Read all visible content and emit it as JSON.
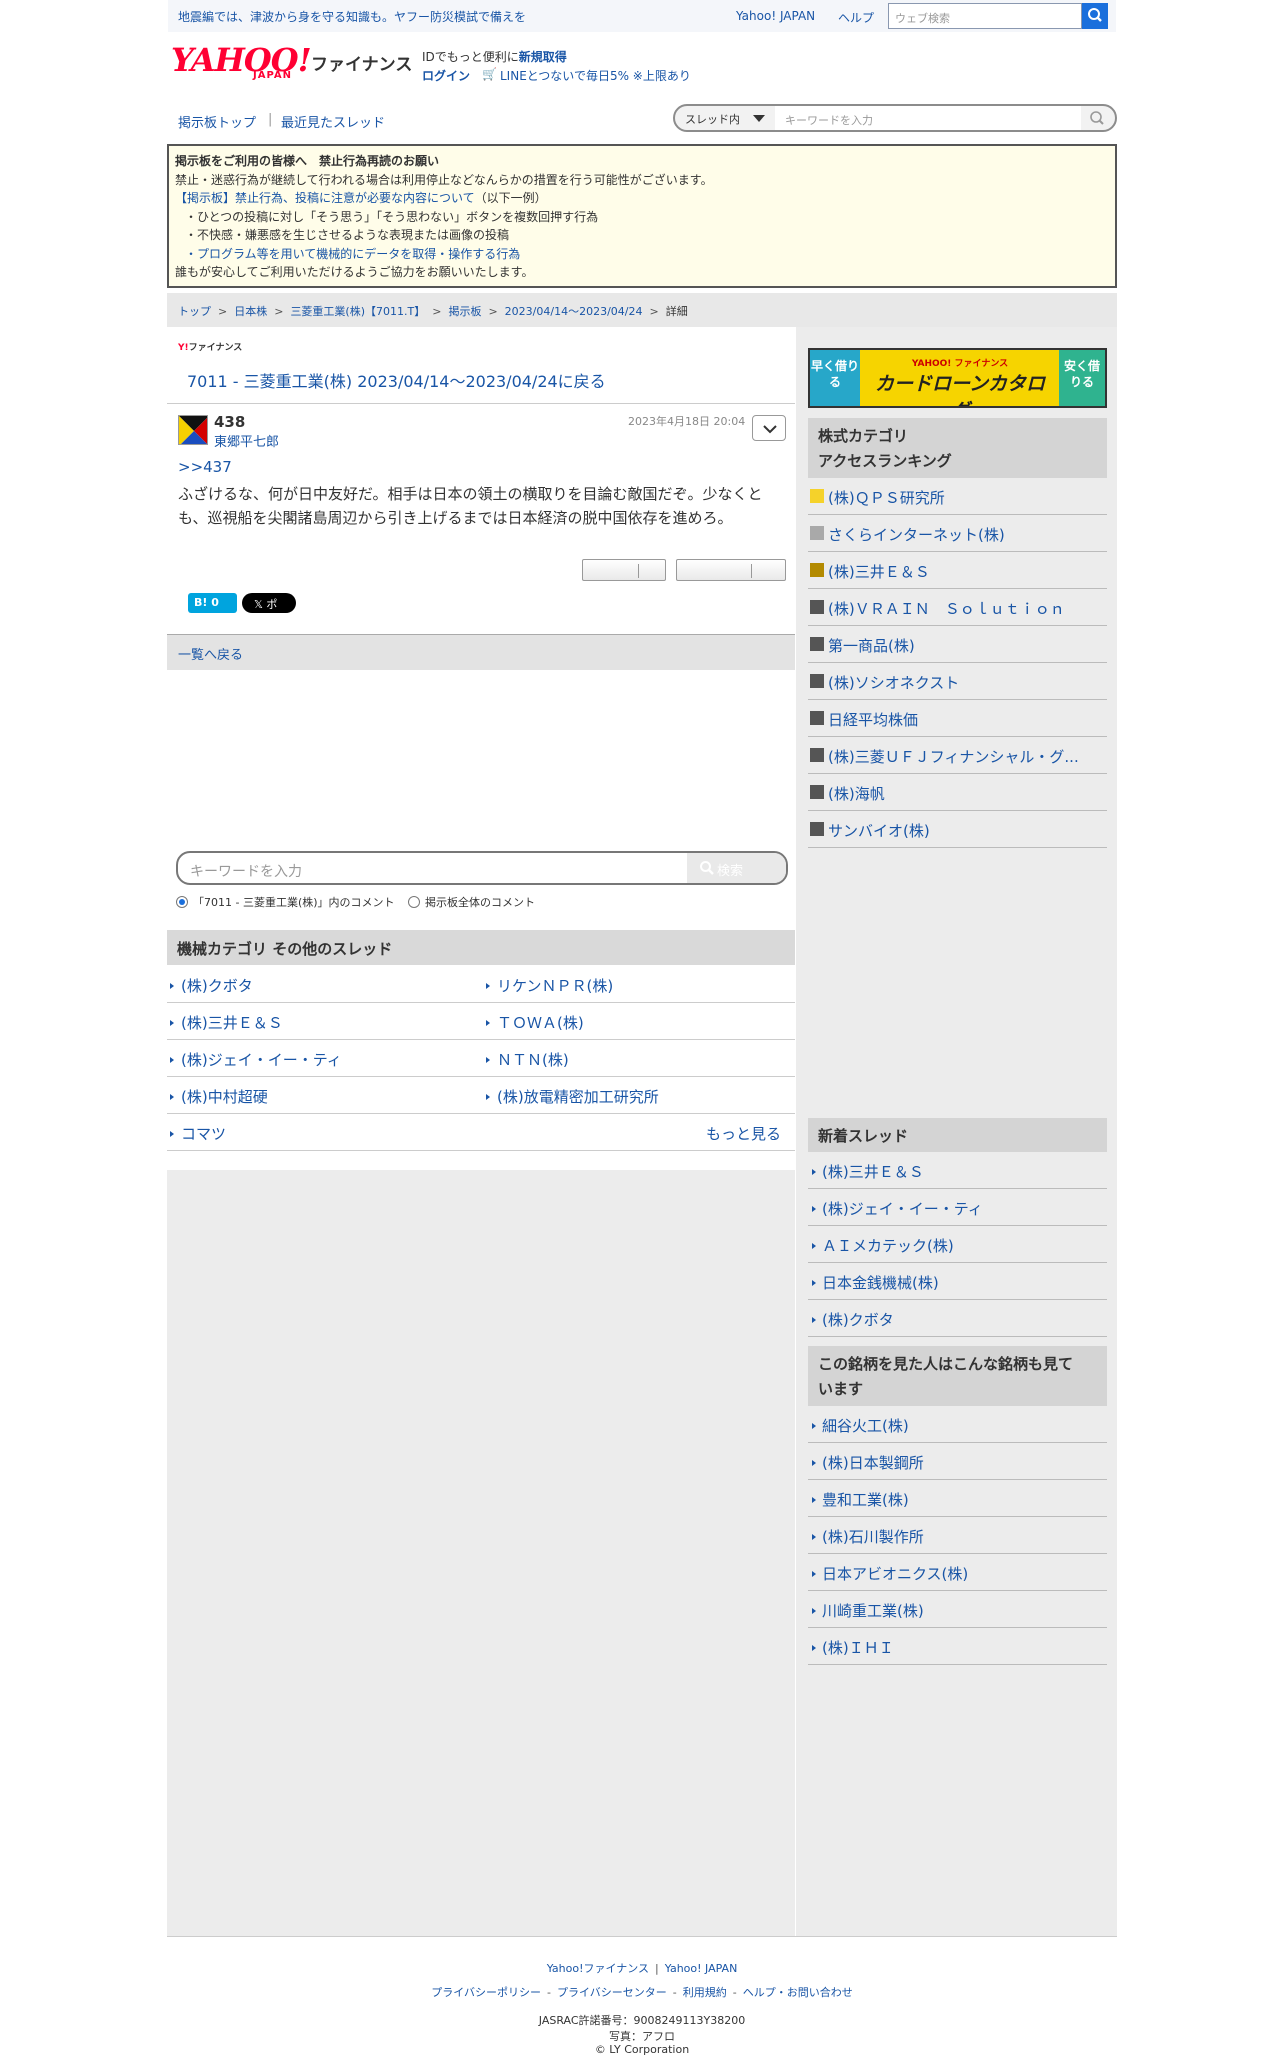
{
  "promo": "地震編では、津波から身を守る知識も。ヤフー防災模試で備えを",
  "top_links": {
    "yahoo_japan": "Yahoo! JAPAN",
    "help": "ヘルプ"
  },
  "web_search": {
    "placeholder": "ウェブ検索"
  },
  "logo": {
    "yahoo": "YAHOO!",
    "japan": "JAPAN",
    "finance": "ファイナンス"
  },
  "account": {
    "id_promo_prefix": "IDでもっと便利に",
    "id_promo_link": "新規取得",
    "login": "ログイン",
    "line_promo": "LINEとつないで毎日5% ※上限あり"
  },
  "board_nav": {
    "top": "掲示板トップ",
    "sep": "|",
    "recent": "最近見たスレッド"
  },
  "thread_search": {
    "scope": "スレッド内",
    "placeholder": "キーワードを入力"
  },
  "notice": {
    "title": "掲示板をご利用の皆様へ　禁止行為再読のお願い",
    "line1": "禁止・迷惑行為が継続して行われる場合は利用停止などなんらかの措置を行う可能性がございます。",
    "link": "【掲示板】禁止行為、投稿に注意が必要な内容について",
    "link_suffix": "（以下一例）",
    "item1": "・ひとつの投稿に対し「そう思う」「そう思わない」ボタンを複数回押す行為",
    "item2": "・不快感・嫌悪感を生じさせるような表現または画像の投稿",
    "item3": "・プログラム等を用いて機械的にデータを取得・操作する行為",
    "closing": "誰もが安心してご利用いただけるようご協力をお願いいたします。"
  },
  "breadcrumb": [
    "トップ",
    "日本株",
    "三菱重工業(株)【7011.T】",
    "掲示板",
    "2023/04/14～2023/04/24",
    "詳細"
  ],
  "fin_small": {
    "y": "Y!",
    "text": "ファイナンス"
  },
  "thread_title": "7011 - 三菱重工業(株) 2023/04/14～2023/04/24に戻る",
  "post": {
    "number": "438",
    "user": "東郷平七郎",
    "date": "2023年4月18日 20:04",
    "reply_to": ">>437",
    "body": "ふざけるな、何が日中友好だ。相手は日本の領土の横取りを目論む敵国だぞ。少なくとも、巡視船を尖閣諸島周辺から引き上げるまでは日本経済の脱中国依存を進めろ。"
  },
  "share": {
    "hatena": "B! 0",
    "x": "𝕏 ポスト"
  },
  "back_to_list": "一覧へ戻る",
  "keyword_search": {
    "placeholder": "キーワードを入力",
    "button": "検索",
    "radio_thread": "「7011 - 三菱重工業(株)」内のコメント",
    "radio_all": "掲示板全体のコメント"
  },
  "category": {
    "title": "機械カテゴリ  その他のスレッド",
    "left": [
      "(株)クボタ",
      "(株)三井Ｅ＆Ｓ",
      "(株)ジェイ・イー・ティ",
      "(株)中村超硬",
      "コマツ"
    ],
    "right": [
      "リケンＮＰＲ(株)",
      "ＴＯＷＡ(株)",
      "ＮＴＮ(株)",
      "(株)放電精密加工研究所"
    ],
    "more": "もっと見る"
  },
  "banner": {
    "left": "早く借りる",
    "right": "安く借りる",
    "sub": "YAHOO! ファイナンス",
    "main": "カードローンカタログ"
  },
  "ranking": {
    "title_line1": "株式カテゴリ",
    "title_line2": "アクセスランキング",
    "items": [
      "(株)ＱＰＳ研究所",
      "さくらインターネット(株)",
      "(株)三井Ｅ＆Ｓ",
      "(株)ＶＲＡＩＮ　Ｓｏｌｕｔｉｏｎ",
      "第一商品(株)",
      "(株)ソシオネクスト",
      "日経平均株価",
      "(株)三菱ＵＦＪフィナンシャル・グ...",
      "(株)海帆",
      "サンバイオ(株)"
    ],
    "colors": [
      "#f5d22a",
      "#a9a9a9",
      "#b38a00",
      "#555555",
      "#555555",
      "#555555",
      "#555555",
      "#555555",
      "#555555",
      "#555555"
    ]
  },
  "new_threads": {
    "title": "新着スレッド",
    "items": [
      "(株)三井Ｅ＆Ｓ",
      "(株)ジェイ・イー・ティ",
      "ＡＩメカテック(株)",
      "日本金銭機械(株)",
      "(株)クボタ"
    ]
  },
  "also_viewed": {
    "title_line1": "この銘柄を見た人はこんな銘柄も見て",
    "title_line2": "います",
    "items": [
      "細谷火工(株)",
      "(株)日本製鋼所",
      "豊和工業(株)",
      "(株)石川製作所",
      "日本アビオニクス(株)",
      "川崎重工業(株)",
      "(株)ＩＨＩ"
    ]
  },
  "footer": {
    "links1": [
      "Yahoo!ファイナンス",
      "Yahoo! JAPAN"
    ],
    "links2": [
      "プライバシーポリシー",
      "プライバシーセンター",
      "利用規約",
      "ヘルプ・お問い合わせ"
    ],
    "jasrac": "JASRAC許諾番号：9008249113Y38200",
    "photo": "写真：アフロ",
    "copyright": "© LY Corporation"
  }
}
